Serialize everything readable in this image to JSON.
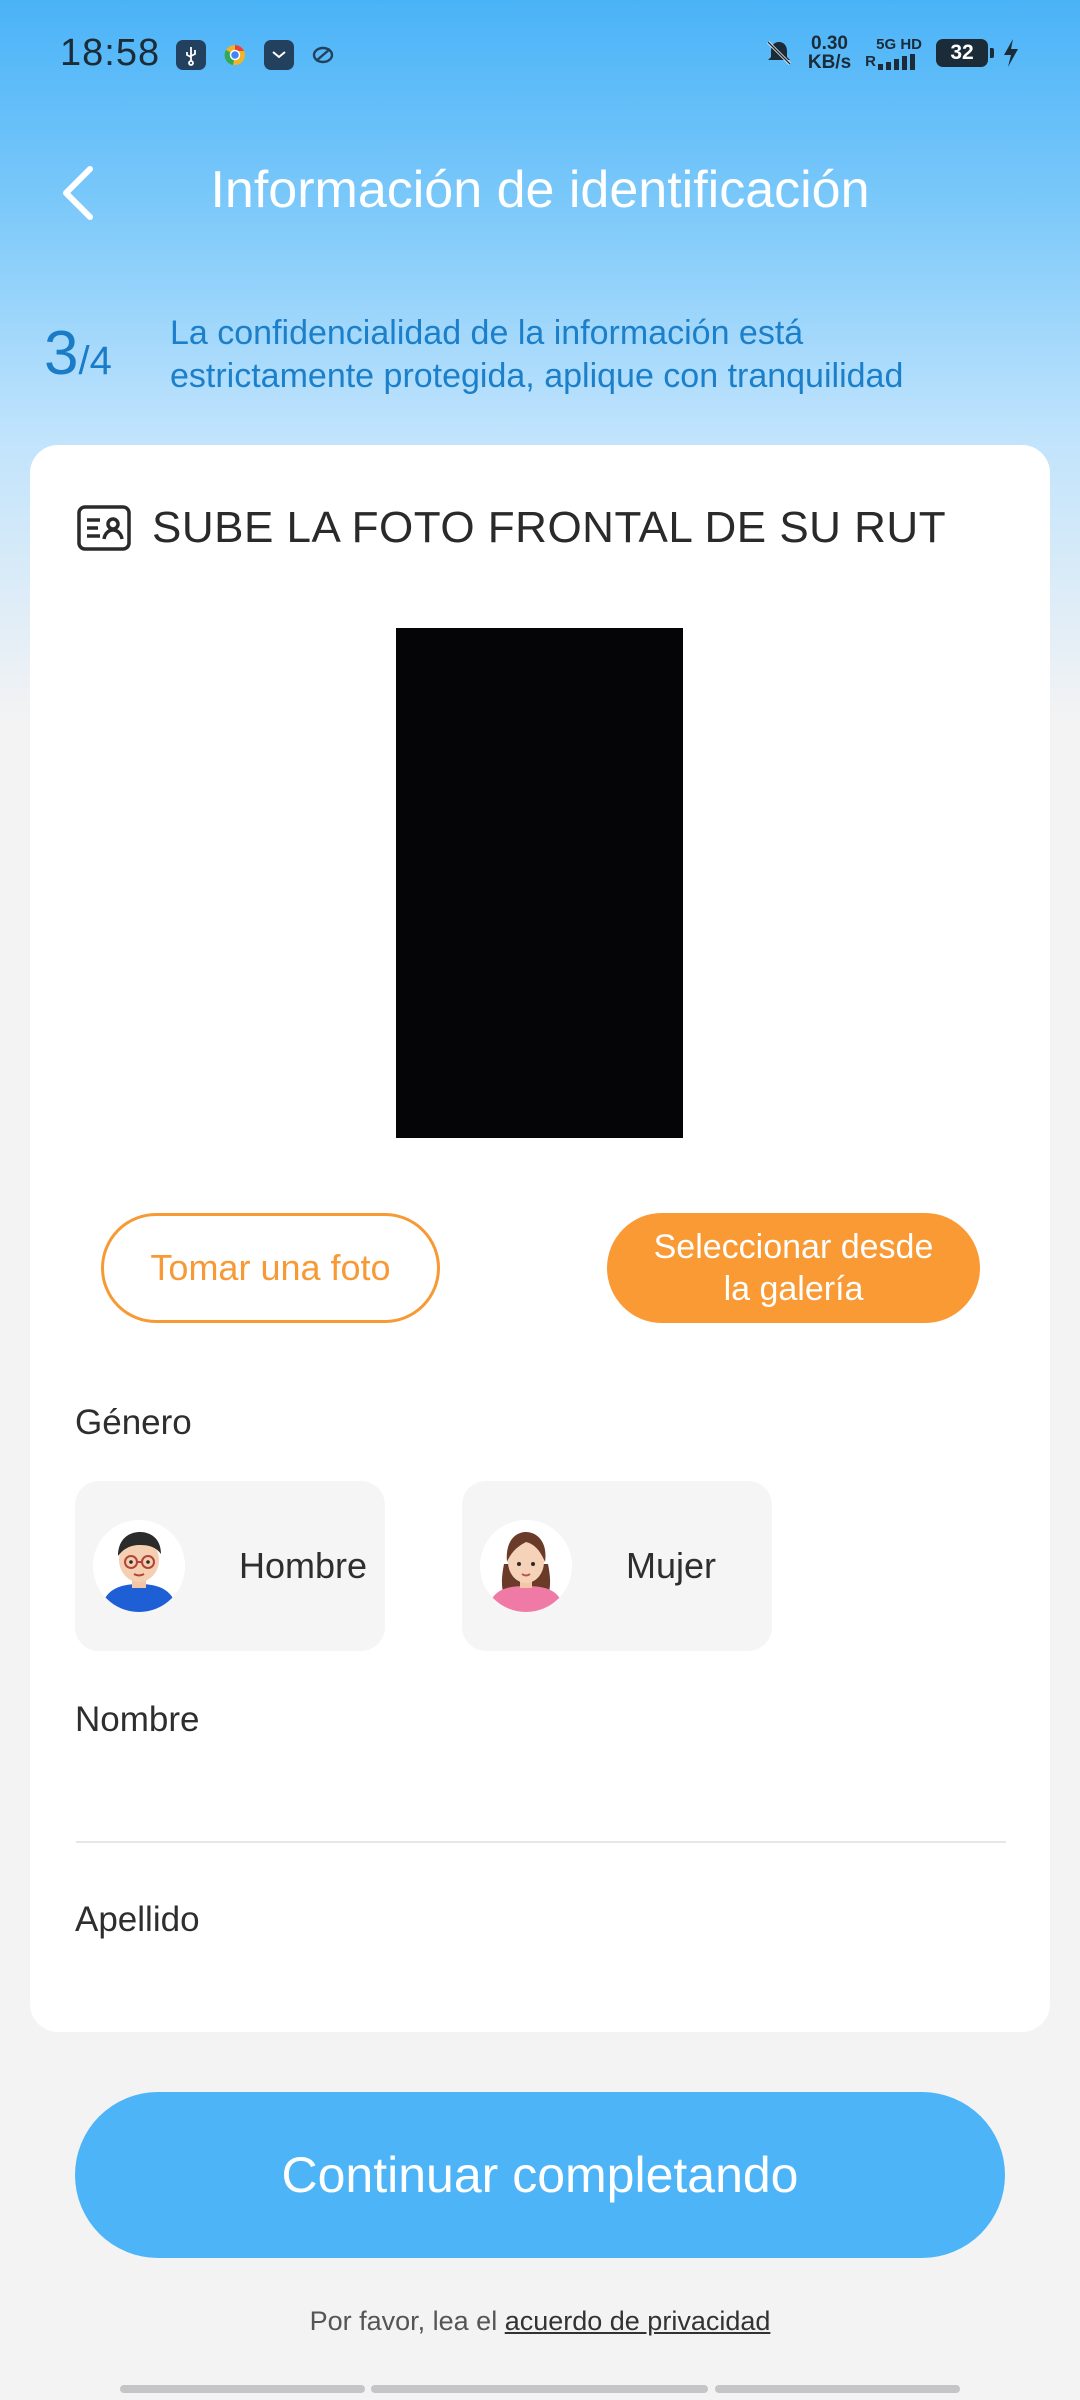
{
  "status_bar": {
    "time": "18:58",
    "net_speed_value": "0.30",
    "net_speed_unit": "KB/s",
    "network_type": "5G HD",
    "signal_prefix": "R",
    "battery": "32",
    "icons": [
      "usb-icon",
      "chrome-icon",
      "mail-icon",
      "sync-icon",
      "mute-icon",
      "signal-icon",
      "battery-icon",
      "charging-icon"
    ]
  },
  "header": {
    "back_icon": "chevron-left-icon",
    "title": "Información de identificación"
  },
  "progress": {
    "current": "3",
    "total": "/4",
    "note": "La confidencialidad de la información está estrictamente protegida, aplique con tranquilidad"
  },
  "card": {
    "icon": "id-card-icon",
    "title": "SUBE LA FOTO FRONTAL DE SU RUT",
    "take_photo_label": "Tomar una foto",
    "gallery_label": "Seleccionar desde la galería",
    "gender_label": "Género",
    "gender_options": [
      {
        "label": "Hombre",
        "icon": "male-avatar-icon"
      },
      {
        "label": "Mujer",
        "icon": "female-avatar-icon"
      }
    ],
    "first_name_label": "Nombre",
    "first_name_value": "",
    "last_name_label": "Apellido",
    "last_name_value": ""
  },
  "footer": {
    "continue_label": "Continuar completando",
    "privacy_prefix": "Por favor, lea el ",
    "privacy_link": "acuerdo de privacidad"
  },
  "colors": {
    "primary_blue": "#4cb4f7",
    "accent_orange": "#f99a35",
    "step_blue": "#1a7cc7"
  }
}
